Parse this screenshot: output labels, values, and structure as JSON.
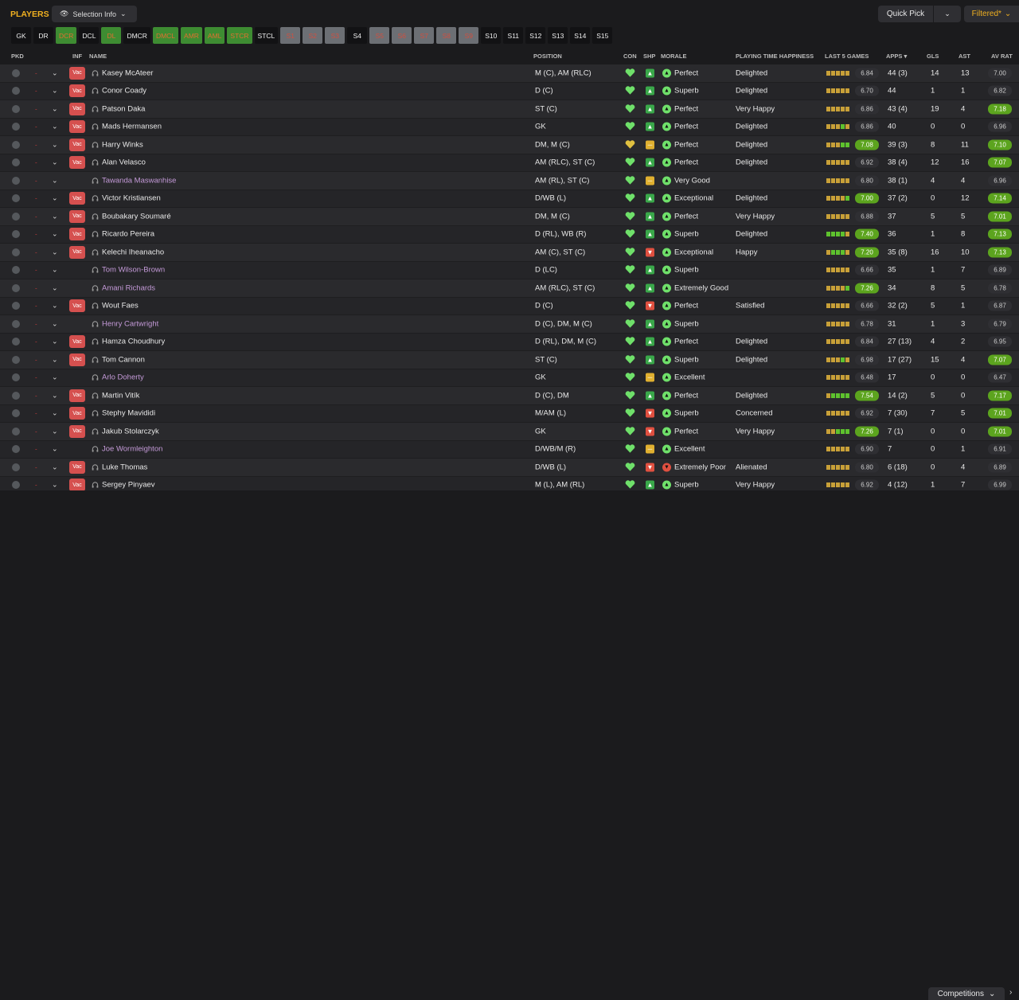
{
  "header": {
    "title": "PLAYERS",
    "selection_info": "Selection Info",
    "quick_pick": "Quick Pick",
    "filtered": "Filtered*"
  },
  "positions": [
    {
      "label": "GK",
      "state": "dark"
    },
    {
      "label": "DR",
      "state": "dark"
    },
    {
      "label": "DCR",
      "state": "green"
    },
    {
      "label": "DCL",
      "state": "dark"
    },
    {
      "label": "DL",
      "state": "green"
    },
    {
      "label": "DMCR",
      "state": "dark"
    },
    {
      "label": "DMCL",
      "state": "green"
    },
    {
      "label": "AMR",
      "state": "green"
    },
    {
      "label": "AML",
      "state": "green"
    },
    {
      "label": "STCR",
      "state": "green"
    },
    {
      "label": "STCL",
      "state": "dark"
    },
    {
      "label": "S1",
      "state": "grey"
    },
    {
      "label": "S2",
      "state": "grey"
    },
    {
      "label": "S3",
      "state": "grey"
    },
    {
      "label": "S4",
      "state": "dark"
    },
    {
      "label": "S5",
      "state": "grey"
    },
    {
      "label": "S6",
      "state": "grey"
    },
    {
      "label": "S7",
      "state": "grey"
    },
    {
      "label": "S8",
      "state": "grey"
    },
    {
      "label": "S9",
      "state": "grey"
    },
    {
      "label": "S10",
      "state": "dark"
    },
    {
      "label": "S11",
      "state": "dark"
    },
    {
      "label": "S12",
      "state": "dark"
    },
    {
      "label": "S13",
      "state": "dark"
    },
    {
      "label": "S14",
      "state": "dark"
    },
    {
      "label": "S15",
      "state": "dark"
    }
  ],
  "columns": {
    "pkd": "PKD",
    "inf": "INF",
    "name": "NAME",
    "position": "POSITION",
    "con": "CON",
    "shp": "SHP",
    "morale": "MORALE",
    "pth": "PLAYING TIME HAPPINESS",
    "last5": "LAST 5 GAMES",
    "apps": "APPS",
    "gls": "GLS",
    "ast": "AST",
    "avrat": "AV RAT"
  },
  "vac_label": "Vac",
  "colors": {
    "accent": "#f0b020",
    "good": "#5ca41e",
    "con_green": "#6fe06a",
    "con_yellow": "#e0c040"
  },
  "players": [
    {
      "name": "Kasey McAteer",
      "vac": true,
      "purple": false,
      "pos": "M (C), AM (RLC)",
      "con": "green",
      "shp": "green",
      "morale": "Perfect",
      "pth": "Delighted",
      "bars": "yyyyy",
      "l5": "6.84",
      "l5hi": false,
      "apps": "44 (3)",
      "gls": "14",
      "ast": "13",
      "avr": "7.00",
      "avrhi": false
    },
    {
      "name": "Conor Coady",
      "vac": true,
      "purple": false,
      "pos": "D (C)",
      "con": "green",
      "shp": "green",
      "morale": "Superb",
      "pth": "Delighted",
      "bars": "yyyyy",
      "l5": "6.70",
      "l5hi": false,
      "apps": "44",
      "gls": "1",
      "ast": "1",
      "avr": "6.82",
      "avrhi": false
    },
    {
      "name": "Patson Daka",
      "vac": true,
      "purple": false,
      "pos": "ST (C)",
      "con": "green",
      "shp": "green",
      "morale": "Perfect",
      "pth": "Very Happy",
      "bars": "yyyyy",
      "l5": "6.86",
      "l5hi": false,
      "apps": "43 (4)",
      "gls": "19",
      "ast": "4",
      "avr": "7.18",
      "avrhi": true
    },
    {
      "name": "Mads Hermansen",
      "vac": true,
      "purple": false,
      "pos": "GK",
      "con": "green",
      "shp": "green",
      "morale": "Perfect",
      "pth": "Delighted",
      "bars": "yyygy",
      "l5": "6.86",
      "l5hi": false,
      "apps": "40",
      "gls": "0",
      "ast": "0",
      "avr": "6.96",
      "avrhi": false
    },
    {
      "name": "Harry Winks",
      "vac": true,
      "purple": false,
      "pos": "DM, M (C)",
      "con": "yellow",
      "shp": "yellow",
      "morale": "Perfect",
      "pth": "Delighted",
      "bars": "yyygg",
      "l5": "7.08",
      "l5hi": true,
      "apps": "39 (3)",
      "gls": "8",
      "ast": "11",
      "avr": "7.10",
      "avrhi": true
    },
    {
      "name": "Alan Velasco",
      "vac": true,
      "purple": false,
      "pos": "AM (RLC), ST (C)",
      "con": "green",
      "shp": "green",
      "morale": "Perfect",
      "pth": "Delighted",
      "bars": "yyyyy",
      "l5": "6.92",
      "l5hi": false,
      "apps": "38 (4)",
      "gls": "12",
      "ast": "16",
      "avr": "7.07",
      "avrhi": true
    },
    {
      "name": "Tawanda Maswanhise",
      "vac": false,
      "purple": true,
      "pos": "AM (RL), ST (C)",
      "con": "green",
      "shp": "yellow",
      "morale": "Very Good",
      "pth": "",
      "bars": "yyyyy",
      "l5": "6.80",
      "l5hi": false,
      "apps": "38 (1)",
      "gls": "4",
      "ast": "4",
      "avr": "6.96",
      "avrhi": false
    },
    {
      "name": "Victor Kristiansen",
      "vac": true,
      "purple": false,
      "pos": "D/WB (L)",
      "con": "green",
      "shp": "green",
      "morale": "Exceptional",
      "pth": "Delighted",
      "bars": "yyyyg",
      "l5": "7.00",
      "l5hi": true,
      "apps": "37 (2)",
      "gls": "0",
      "ast": "12",
      "avr": "7.14",
      "avrhi": true
    },
    {
      "name": "Boubakary Soumaré",
      "vac": true,
      "purple": false,
      "pos": "DM, M (C)",
      "con": "green",
      "shp": "green",
      "morale": "Perfect",
      "pth": "Very Happy",
      "bars": "yyyyy",
      "l5": "6.88",
      "l5hi": false,
      "apps": "37",
      "gls": "5",
      "ast": "5",
      "avr": "7.01",
      "avrhi": true
    },
    {
      "name": "Ricardo Pereira",
      "vac": true,
      "purple": false,
      "pos": "D (RL), WB (R)",
      "con": "green",
      "shp": "green",
      "morale": "Superb",
      "pth": "Delighted",
      "bars": "ggggy",
      "l5": "7.40",
      "l5hi": true,
      "apps": "36",
      "gls": "1",
      "ast": "8",
      "avr": "7.13",
      "avrhi": true
    },
    {
      "name": "Kelechi Iheanacho",
      "vac": true,
      "purple": false,
      "pos": "AM (C), ST (C)",
      "con": "green",
      "shp": "red",
      "morale": "Exceptional",
      "pth": "Happy",
      "bars": "ygggy",
      "l5": "7.20",
      "l5hi": true,
      "apps": "35 (8)",
      "gls": "16",
      "ast": "10",
      "avr": "7.13",
      "avrhi": true
    },
    {
      "name": "Tom Wilson-Brown",
      "vac": false,
      "purple": true,
      "pos": "D (LC)",
      "con": "green",
      "shp": "green",
      "morale": "Superb",
      "pth": "",
      "bars": "yyyyy",
      "l5": "6.66",
      "l5hi": false,
      "apps": "35",
      "gls": "1",
      "ast": "7",
      "avr": "6.89",
      "avrhi": false
    },
    {
      "name": "Amani Richards",
      "vac": false,
      "purple": true,
      "pos": "AM (RLC), ST (C)",
      "con": "green",
      "shp": "green",
      "morale": "Extremely Good",
      "pth": "",
      "bars": "yyyyg",
      "l5": "7.26",
      "l5hi": true,
      "apps": "34",
      "gls": "8",
      "ast": "5",
      "avr": "6.78",
      "avrhi": false
    },
    {
      "name": "Wout Faes",
      "vac": true,
      "purple": false,
      "pos": "D (C)",
      "con": "green",
      "shp": "red",
      "morale": "Perfect",
      "pth": "Satisfied",
      "bars": "yyyyy",
      "l5": "6.66",
      "l5hi": false,
      "apps": "32 (2)",
      "gls": "5",
      "ast": "1",
      "avr": "6.87",
      "avrhi": false
    },
    {
      "name": "Henry Cartwright",
      "vac": false,
      "purple": true,
      "pos": "D (C), DM, M (C)",
      "con": "green",
      "shp": "green",
      "morale": "Superb",
      "pth": "",
      "bars": "yyyyy",
      "l5": "6.78",
      "l5hi": false,
      "apps": "31",
      "gls": "1",
      "ast": "3",
      "avr": "6.79",
      "avrhi": false
    },
    {
      "name": "Hamza Choudhury",
      "vac": true,
      "purple": false,
      "pos": "D (RL), DM, M (C)",
      "con": "green",
      "shp": "green",
      "morale": "Perfect",
      "pth": "Delighted",
      "bars": "yyyyy",
      "l5": "6.84",
      "l5hi": false,
      "apps": "27 (13)",
      "gls": "4",
      "ast": "2",
      "avr": "6.95",
      "avrhi": false
    },
    {
      "name": "Tom Cannon",
      "vac": true,
      "purple": false,
      "pos": "ST (C)",
      "con": "green",
      "shp": "green",
      "morale": "Superb",
      "pth": "Delighted",
      "bars": "yyygy",
      "l5": "6.98",
      "l5hi": false,
      "apps": "17 (27)",
      "gls": "15",
      "ast": "4",
      "avr": "7.07",
      "avrhi": true
    },
    {
      "name": "Arlo Doherty",
      "vac": false,
      "purple": true,
      "pos": "GK",
      "con": "green",
      "shp": "yellow",
      "morale": "Excellent",
      "pth": "",
      "bars": "yyyyy",
      "l5": "6.48",
      "l5hi": false,
      "apps": "17",
      "gls": "0",
      "ast": "0",
      "avr": "6.47",
      "avrhi": false
    },
    {
      "name": "Martin Vitík",
      "vac": true,
      "purple": false,
      "pos": "D (C), DM",
      "con": "green",
      "shp": "green",
      "morale": "Perfect",
      "pth": "Delighted",
      "bars": "ygggg",
      "l5": "7.54",
      "l5hi": true,
      "apps": "14 (2)",
      "gls": "5",
      "ast": "0",
      "avr": "7.17",
      "avrhi": true
    },
    {
      "name": "Stephy Mavididi",
      "vac": true,
      "purple": false,
      "pos": "M/AM (L)",
      "con": "green",
      "shp": "red",
      "morale": "Superb",
      "pth": "Concerned",
      "bars": "yyyyy",
      "l5": "6.92",
      "l5hi": false,
      "apps": "7 (30)",
      "gls": "7",
      "ast": "5",
      "avr": "7.01",
      "avrhi": true
    },
    {
      "name": "Jakub Stolarczyk",
      "vac": true,
      "purple": false,
      "pos": "GK",
      "con": "green",
      "shp": "red",
      "morale": "Perfect",
      "pth": "Very Happy",
      "bars": "yyggg",
      "l5": "7.26",
      "l5hi": true,
      "apps": "7 (1)",
      "gls": "0",
      "ast": "0",
      "avr": "7.01",
      "avrhi": true
    },
    {
      "name": "Joe Wormleighton",
      "vac": false,
      "purple": true,
      "pos": "D/WB/M (R)",
      "con": "green",
      "shp": "yellow",
      "morale": "Excellent",
      "pth": "",
      "bars": "yyyyy",
      "l5": "6.90",
      "l5hi": false,
      "apps": "7",
      "gls": "0",
      "ast": "1",
      "avr": "6.91",
      "avrhi": false
    },
    {
      "name": "Luke Thomas",
      "vac": true,
      "purple": false,
      "pos": "D/WB (L)",
      "con": "green",
      "shp": "red",
      "morale": "Extremely Poor",
      "pth": "Alienated",
      "bars": "yyyyy",
      "l5": "6.80",
      "l5hi": false,
      "apps": "6 (18)",
      "gls": "0",
      "ast": "4",
      "avr": "6.89",
      "avrhi": false
    },
    {
      "name": "Sergey Pinyaev",
      "vac": true,
      "purple": false,
      "pos": "M (L), AM (RL)",
      "con": "green",
      "shp": "green",
      "morale": "Superb",
      "pth": "Very Happy",
      "bars": "yyyyy",
      "l5": "6.92",
      "l5hi": false,
      "apps": "4 (12)",
      "gls": "1",
      "ast": "7",
      "avr": "6.99",
      "avrhi": false
    }
  ],
  "footer": {
    "competitions": "Competitions"
  }
}
